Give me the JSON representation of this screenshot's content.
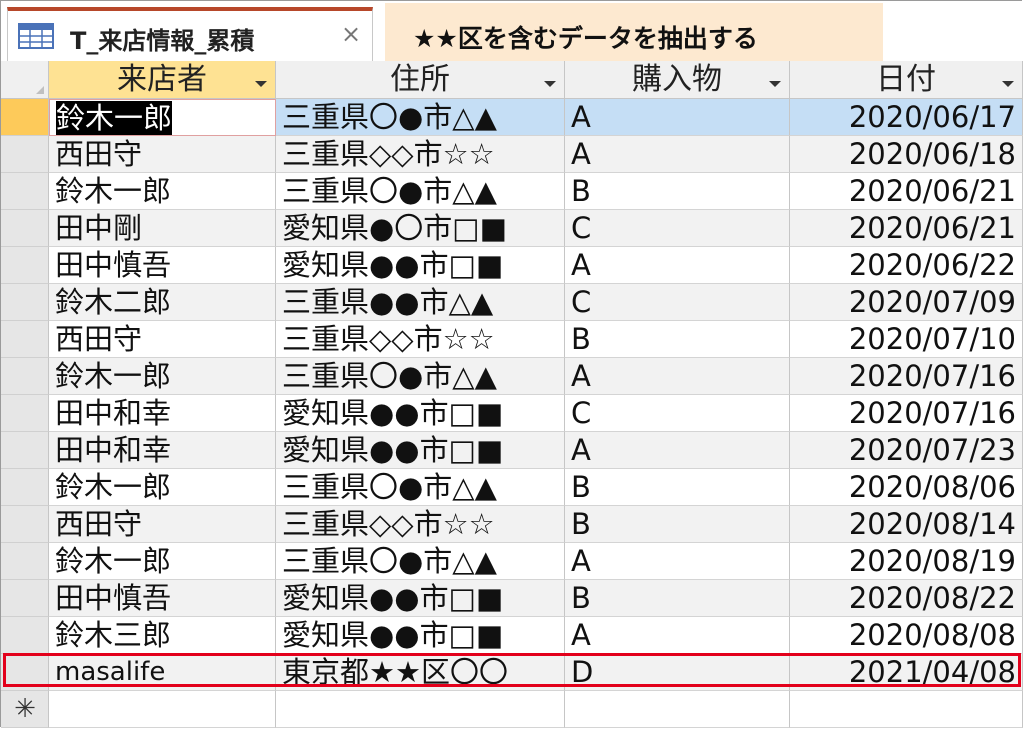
{
  "tab": {
    "title": "T_来店情報_累積",
    "close_glyph": "×"
  },
  "annotation": {
    "text": "★★区を含むデータを抽出する"
  },
  "columns": [
    "来店者",
    "住所",
    "購入物",
    "日付"
  ],
  "new_row_marker": "✳",
  "rows": [
    [
      "鈴木一郎",
      "三重県〇●市△▲",
      "A",
      "2020/06/17"
    ],
    [
      "西田守",
      "三重県◇◇市☆☆",
      "A",
      "2020/06/18"
    ],
    [
      "鈴木一郎",
      "三重県〇●市△▲",
      "B",
      "2020/06/21"
    ],
    [
      "田中剛",
      "愛知県●〇市□■",
      "C",
      "2020/06/21"
    ],
    [
      "田中慎吾",
      "愛知県●●市□■",
      "A",
      "2020/06/22"
    ],
    [
      "鈴木二郎",
      "三重県●●市△▲",
      "C",
      "2020/07/09"
    ],
    [
      "西田守",
      "三重県◇◇市☆☆",
      "B",
      "2020/07/10"
    ],
    [
      "鈴木一郎",
      "三重県〇●市△▲",
      "A",
      "2020/07/16"
    ],
    [
      "田中和幸",
      "愛知県●●市□■",
      "C",
      "2020/07/16"
    ],
    [
      "田中和幸",
      "愛知県●●市□■",
      "A",
      "2020/07/23"
    ],
    [
      "鈴木一郎",
      "三重県〇●市△▲",
      "B",
      "2020/08/06"
    ],
    [
      "西田守",
      "三重県◇◇市☆☆",
      "B",
      "2020/08/14"
    ],
    [
      "鈴木一郎",
      "三重県〇●市△▲",
      "A",
      "2020/08/19"
    ],
    [
      "田中慎吾",
      "愛知県●●市□■",
      "B",
      "2020/08/22"
    ],
    [
      "鈴木三郎",
      "愛知県●●市□■",
      "A",
      "2020/08/08"
    ],
    [
      "masalife",
      "東京都★★区〇〇",
      "D",
      "2021/04/08"
    ]
  ],
  "colors": {
    "active_header": "#fee293",
    "current_selector": "#fdca5a",
    "selected_row": "#c5def5",
    "highlight_box": "#e3001b",
    "tab_accent": "#b7472a"
  }
}
